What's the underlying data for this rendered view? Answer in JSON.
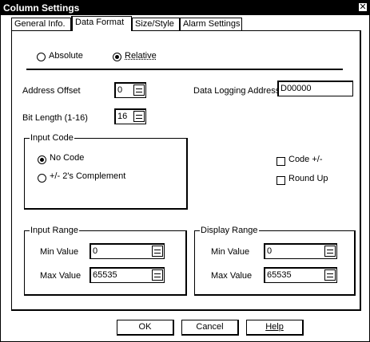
{
  "window": {
    "title": "Column Settings",
    "close_glyph": "✕"
  },
  "tabs": [
    {
      "label": "General Info."
    },
    {
      "label": "Data Format"
    },
    {
      "label": "Size/Style"
    },
    {
      "label": "Alarm Settings"
    }
  ],
  "mode": {
    "absolute_label": "Absolute",
    "relative_label": "Relative",
    "selected": "Relative"
  },
  "address_offset": {
    "label": "Address Offset",
    "value": "0"
  },
  "data_logging_address": {
    "label": "Data Logging Address",
    "value": "D00000"
  },
  "bit_length": {
    "label": "Bit Length (1-16)",
    "value": "16"
  },
  "input_code": {
    "title": "Input Code",
    "options": [
      "No Code",
      "+/- 2's Complement"
    ],
    "selected": "No Code"
  },
  "checkboxes": {
    "code_pm": "Code +/-",
    "round_up": "Round Up"
  },
  "input_range": {
    "title": "Input Range",
    "min_label": "Min Value",
    "min_value": "0",
    "max_label": "Max Value",
    "max_value": "65535"
  },
  "display_range": {
    "title": "Display Range",
    "min_label": "Min Value",
    "min_value": "0",
    "max_label": "Max Value",
    "max_value": "65535"
  },
  "buttons": {
    "ok": "OK",
    "cancel": "Cancel",
    "help": "Help"
  }
}
